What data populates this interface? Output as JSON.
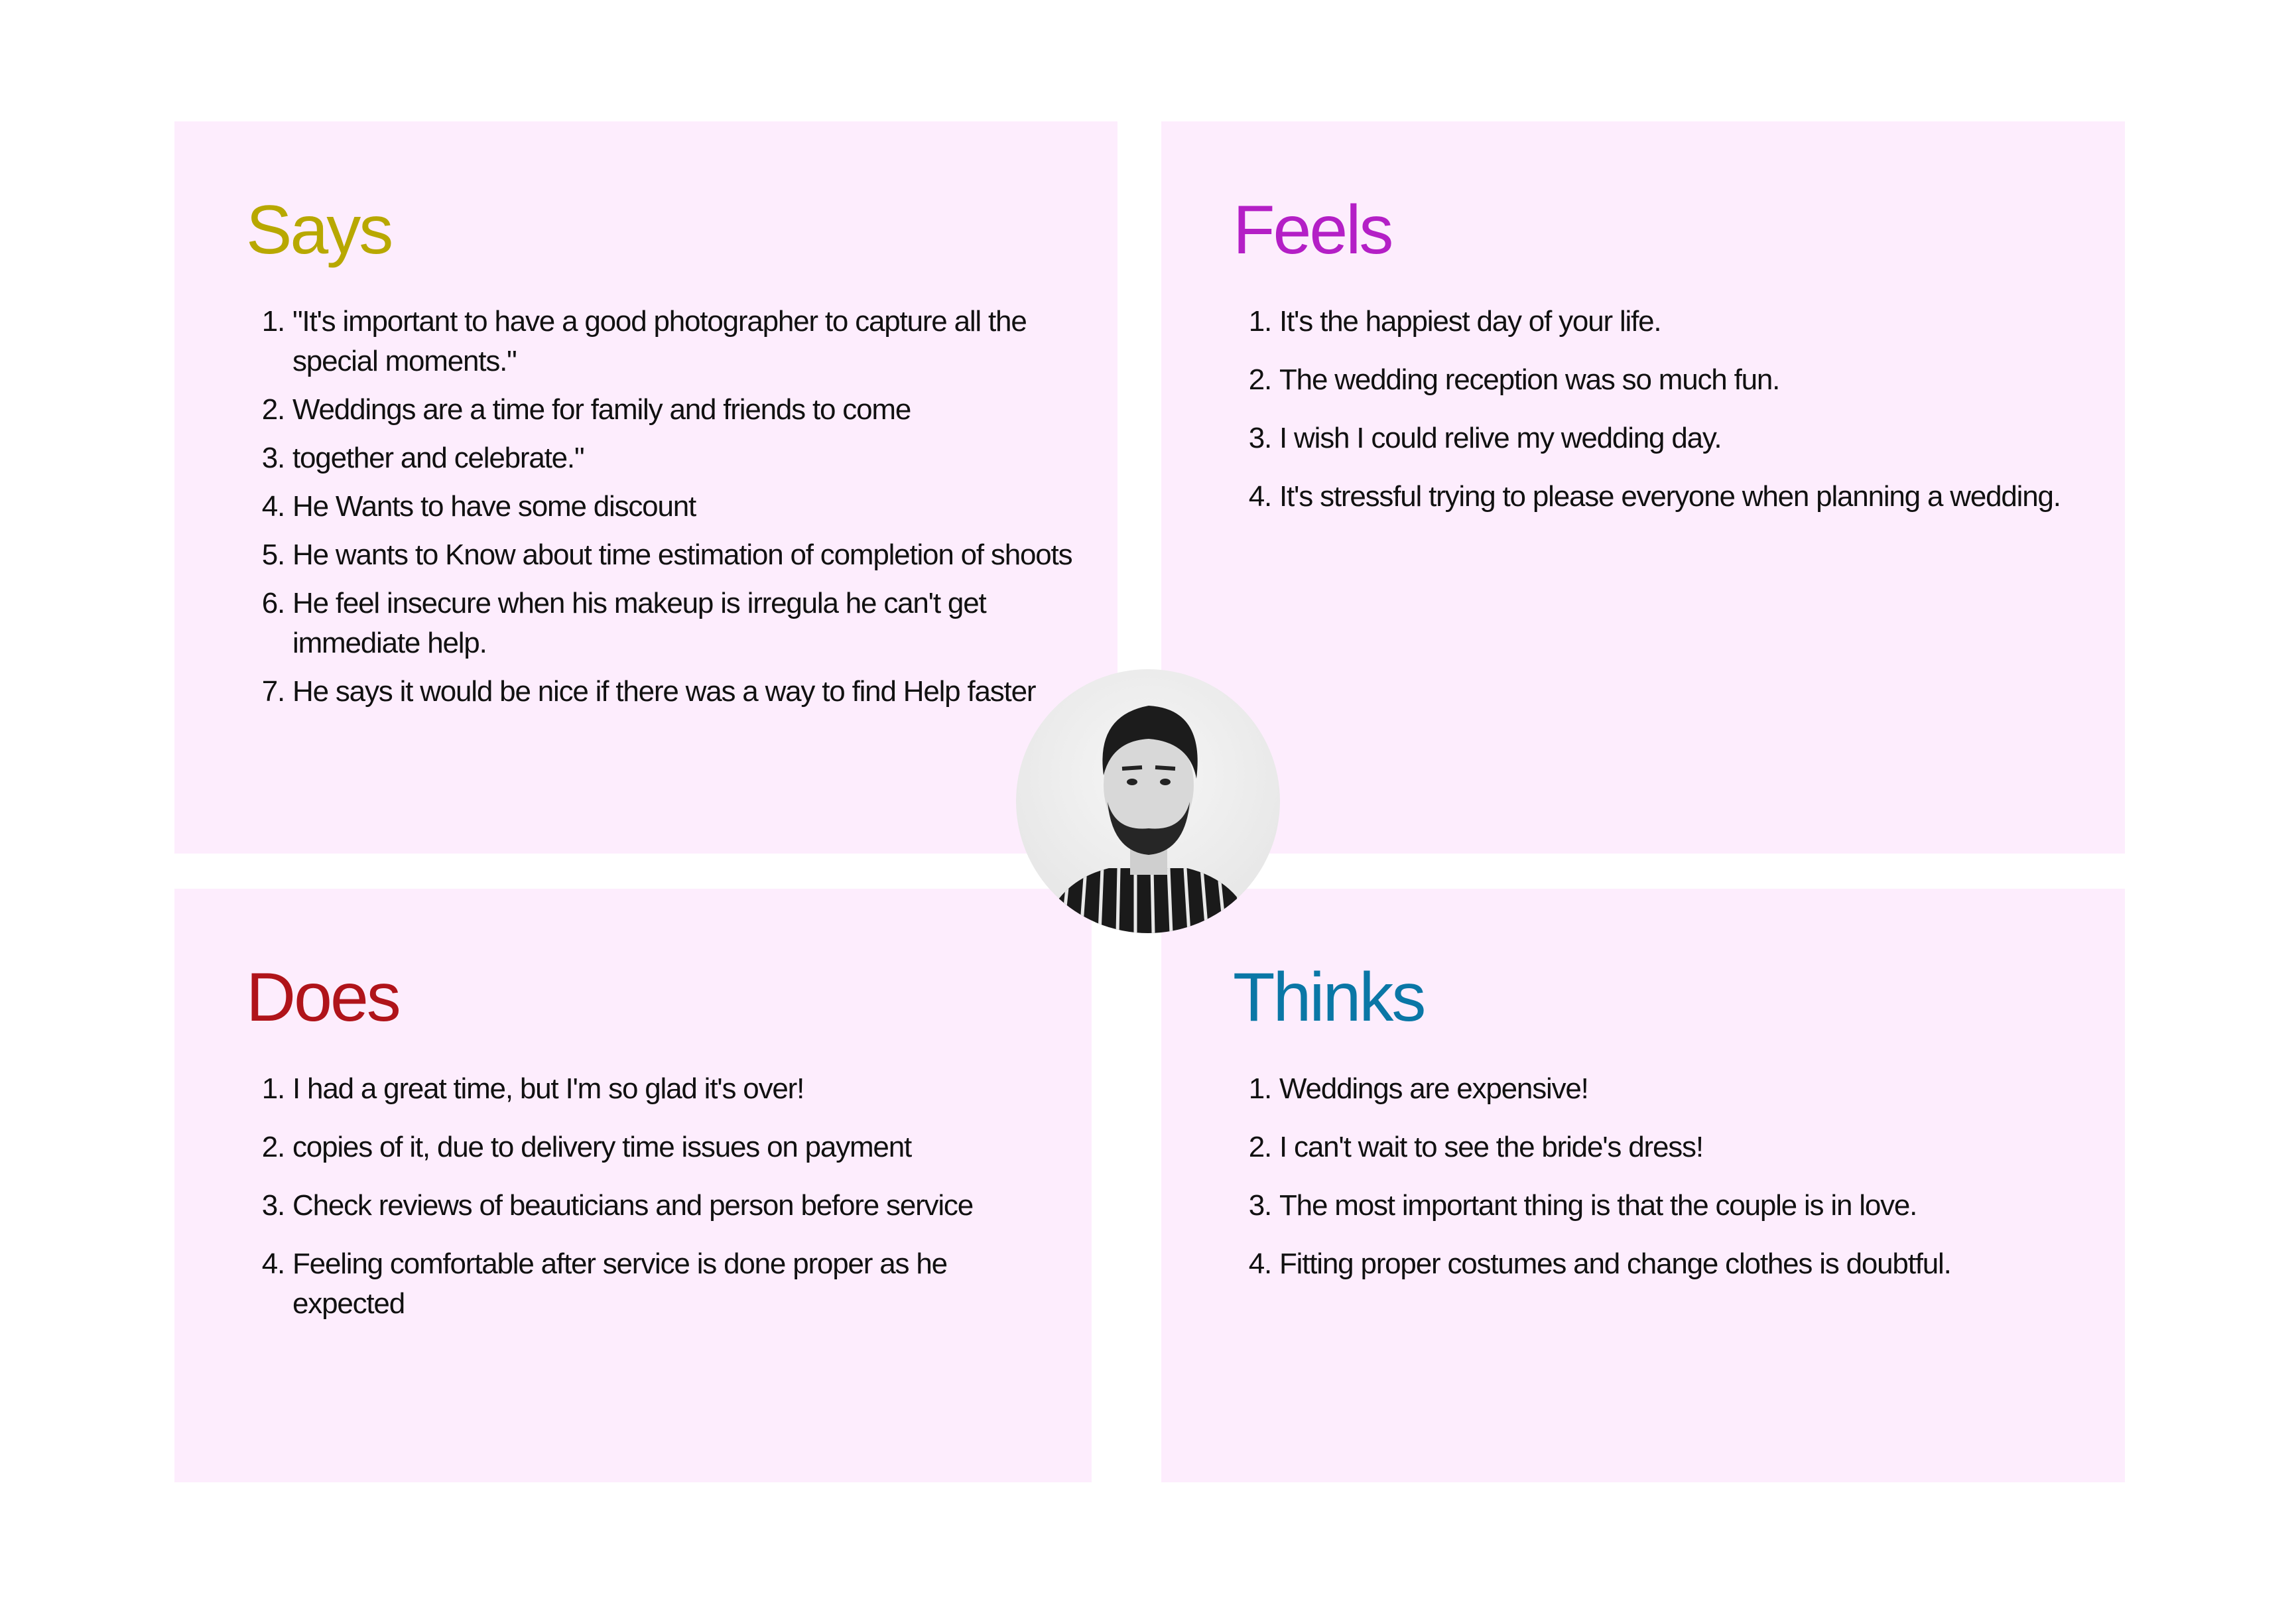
{
  "quadrants": {
    "says": {
      "title": "Says",
      "color": "#b8a800",
      "items": [
        "\"It's important to have a good photographer to capture all the special moments.\"",
        "Weddings are a time for family and friends to come",
        "together and celebrate.\"",
        "He Wants to have some discount",
        "He wants to Know about time estimation of completion of shoots",
        "He feel insecure when his makeup is irregula he can't get immediate help.",
        "He says it would be nice if there was a way to find Help faster"
      ]
    },
    "feels": {
      "title": "Feels",
      "color": "#b41fc6",
      "items": [
        "It's the happiest day of your life.",
        "The wedding reception was so much fun.",
        "I wish I could relive my wedding day.",
        "It's stressful trying to please everyone when planning a wedding."
      ]
    },
    "does": {
      "title": "Does",
      "color": "#b0141a",
      "items": [
        "I had a great time, but I'm so glad it's over!",
        "copies of it, due to delivery time issues on payment",
        "Check reviews of beauticians and person before service",
        "Feeling comfortable after service is done proper as he expected"
      ]
    },
    "thinks": {
      "title": "Thinks",
      "color": "#0a77a6",
      "items": [
        "Weddings are expensive!",
        "I can't wait to see the bride's dress!",
        "The most important thing is that the couple is in love.",
        "Fitting proper costumes and change clothes  is doubtful."
      ]
    }
  }
}
